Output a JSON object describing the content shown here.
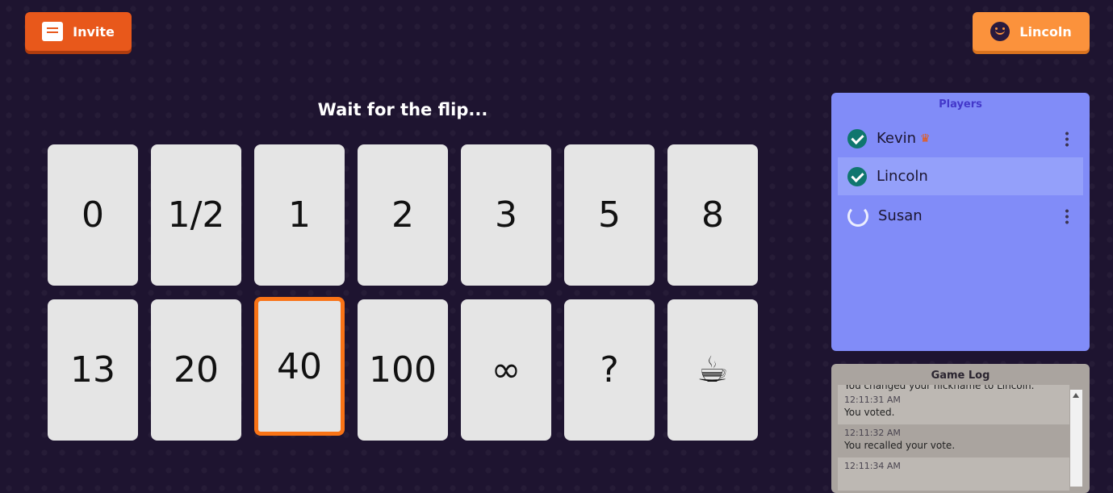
{
  "header": {
    "invite_label": "Invite",
    "user_name": "Lincoln"
  },
  "status_text": "Wait for the flip...",
  "cards": [
    "0",
    "1/2",
    "1",
    "2",
    "3",
    "5",
    "8",
    "13",
    "20",
    "40",
    "100",
    "∞",
    "?",
    "☕"
  ],
  "selected_card": "40",
  "players": {
    "title": "Players",
    "list": [
      {
        "name": "Kevin",
        "voted": true,
        "host": true
      },
      {
        "name": "Lincoln",
        "voted": true,
        "host": false
      },
      {
        "name": "Susan",
        "voted": false,
        "host": false
      }
    ]
  },
  "game_log": {
    "title": "Game Log",
    "partial_entry": "You changed your nickname to Lincoln.",
    "entries": [
      {
        "time": "12:11:31 AM",
        "text": "You voted."
      },
      {
        "time": "12:11:32 AM",
        "text": "You recalled your vote."
      },
      {
        "time": "12:11:34 AM",
        "text": ""
      }
    ]
  },
  "colors": {
    "background": "#1e1430",
    "accent_orange": "#e8581b",
    "user_orange": "#fb923c",
    "players_panel": "#818cf8",
    "log_panel": "#aaa49f",
    "card": "#e5e5e5",
    "selected_border": "#f97316",
    "check_green": "#0f766e"
  }
}
